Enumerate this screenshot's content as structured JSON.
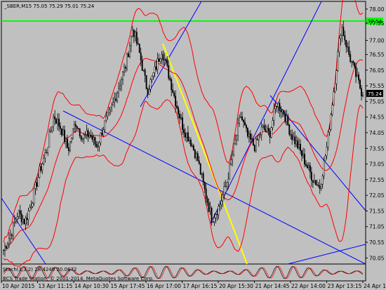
{
  "window": {
    "header": "_SBER,M15  75.05 75.29 75.01 75.24"
  },
  "osc": {
    "label": "Stoch(3,3,2) 28.4249 20.0672",
    "watermark": "BCS Trade Station, © 2001-2014, MetaQuotes Software Corp."
  },
  "colors": {
    "background": "#c0c0c0",
    "candles": "#000000",
    "bands": "#ff0000",
    "trendlines": "#0000ff",
    "yellow_line": "#ffff00",
    "green_line": "#00ff00"
  },
  "chart_data": {
    "type": "candlestick",
    "symbol": "_SBER",
    "timeframe": "M15",
    "ohlc_last": {
      "open": 75.05,
      "high": 75.29,
      "low": 75.01,
      "close": 75.24
    },
    "price_axis_ticks": [
      "78.00",
      "77.55",
      "77.00",
      "76.55",
      "76.05",
      "75.55",
      "75.05",
      "74.55",
      "74.05",
      "73.55",
      "73.05",
      "72.55",
      "72.05",
      "71.55",
      "71.05",
      "70.55",
      "70.05"
    ],
    "time_axis_ticks": [
      "10 Apr 2015",
      "13 Apr 11:15",
      "14 Apr 10:30",
      "15 Apr 17:45",
      "16 Apr 17:00",
      "17 Apr 16:15",
      "20 Apr 15:30",
      "21 Apr 14:45",
      "22 Apr 14:00",
      "23 Apr 13:15",
      "24 Apr 12:30"
    ],
    "price_labels": {
      "green_level": "77.54",
      "current": "75.24"
    },
    "horizontal_line": 77.54,
    "close_path": [
      [
        "0",
        70.3
      ],
      [
        "1",
        70.8
      ],
      [
        "2",
        71.5
      ],
      [
        "3",
        71.2
      ],
      [
        "4",
        71.9
      ],
      [
        "5",
        72.8
      ],
      [
        "6",
        73.5
      ],
      [
        "7",
        74.6
      ],
      [
        "8",
        74.2
      ],
      [
        "9",
        73.5
      ],
      [
        "10",
        74.4
      ],
      [
        "11",
        73.9
      ],
      [
        "12",
        74.0
      ],
      [
        "13",
        73.6
      ],
      [
        "14",
        74.3
      ],
      [
        "15",
        74.8
      ],
      [
        "16",
        75.5
      ],
      [
        "17",
        76.2
      ],
      [
        "18",
        77.4
      ],
      [
        "19",
        76.5
      ],
      [
        "20",
        75.4
      ],
      [
        "21",
        76.0
      ],
      [
        "22",
        76.7
      ],
      [
        "23",
        75.9
      ],
      [
        "24",
        75.0
      ],
      [
        "25",
        74.2
      ],
      [
        "26",
        73.8
      ],
      [
        "27",
        73.2
      ],
      [
        "28",
        72.2
      ],
      [
        "29",
        71.3
      ],
      [
        "30",
        71.7
      ],
      [
        "31",
        72.4
      ],
      [
        "32",
        73.5
      ],
      [
        "33",
        74.6
      ],
      [
        "34",
        73.9
      ],
      [
        "35",
        73.6
      ],
      [
        "36",
        74.2
      ],
      [
        "37",
        74.0
      ],
      [
        "38",
        75.0
      ],
      [
        "39",
        74.7
      ],
      [
        "40",
        74.0
      ],
      [
        "41",
        73.6
      ],
      [
        "42",
        73.1
      ],
      [
        "43",
        72.6
      ],
      [
        "44",
        72.3
      ],
      [
        "45",
        73.6
      ],
      [
        "46",
        75.5
      ],
      [
        "47",
        77.5
      ],
      [
        "48",
        76.6
      ],
      [
        "49",
        75.9
      ],
      [
        "50",
        75.24
      ]
    ]
  }
}
